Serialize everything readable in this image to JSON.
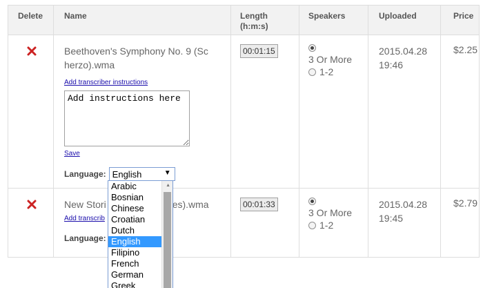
{
  "table": {
    "headers": {
      "delete": "Delete",
      "name": "Name",
      "length": "Length",
      "length_unit": "(h:m:s)",
      "speakers": "Speakers",
      "uploaded": "Uploaded",
      "price": "Price"
    },
    "rows": [
      {
        "name": "Beethoven's Symphony No. 9 (Scherzo).wma",
        "add_instructions_link": "Add transcriber instructions",
        "instructions_placeholder": "Add instructions here",
        "save_link": "Save",
        "language_label": "Language:",
        "language_value": "English",
        "length": "00:01:15",
        "speakers_option_1": "3 Or More",
        "speakers_option_2": "1-2",
        "uploaded_date": "2015.04.28",
        "uploaded_time": "19:46",
        "price": "$2.25"
      },
      {
        "name_start": "New Stori",
        "name_end": "es).wma",
        "add_instructions_link": "Add transcrib",
        "language_label": "Language:",
        "length": "00:01:33",
        "speakers_option_1": "3 Or More",
        "speakers_option_2": "1-2",
        "uploaded_date": "2015.04.28",
        "uploaded_time": "19:45",
        "price": "$2.79"
      }
    ]
  },
  "language_dropdown": {
    "options": [
      "Arabic",
      "Bosnian",
      "Chinese",
      "Croatian",
      "Dutch",
      "English",
      "Filipino",
      "French",
      "German",
      "Greek"
    ],
    "selected": "English"
  },
  "colors": {
    "delete_icon": "#cc2222",
    "selected_option_bg": "#3399ff",
    "link": "#1a0dab"
  },
  "icons": {
    "delete": "close-x-icon",
    "dropdown_arrow": "triangle-down-icon"
  }
}
